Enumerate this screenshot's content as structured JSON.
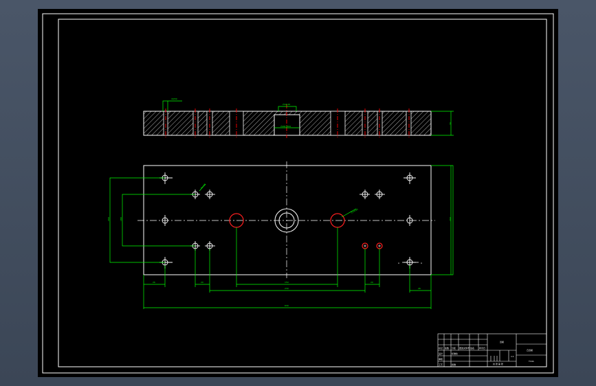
{
  "app": {
    "background": "#000000",
    "outer_frame_color": "#ffffff"
  },
  "colors": {
    "outline": "#ffffff",
    "dimension": "#00ff00",
    "centerline": "#ff0000",
    "hatch": "#ffffff",
    "highlight_hole": "#ff2020"
  },
  "section_view": {
    "dim_top_left": "16/50",
    "dim_top_center": "∅18/25",
    "dim_pocket": "∅28/18h6",
    "dim_thickness": "30"
  },
  "plan_view": {
    "dim_hole_note_left": "4×∅9",
    "dim_hole_note_right": "2×∅20",
    "dim_height_outer": "260",
    "dim_height_inner": "180",
    "dim_height_right": "260",
    "dim_left_offset": "26",
    "dim_left_pair": "20",
    "dim_bottom_center": "150",
    "dim_bottom_long": "230",
    "dim_right_pair": "20",
    "dim_right_offset": "26",
    "dim_total_width": "630",
    "section_mark_left": "A",
    "section_mark_right": "A"
  },
  "title_block": {
    "part_name": "凹模",
    "drawing_no": "凸凹模",
    "material": "T10A",
    "scale": "1:1",
    "sheet_info": "共 张 第 张",
    "rows": [
      "标记",
      "处数",
      "分区",
      "更改文件号",
      "签名",
      "年月日",
      "设计",
      "标准化",
      "审核",
      "工艺",
      "批准"
    ]
  }
}
